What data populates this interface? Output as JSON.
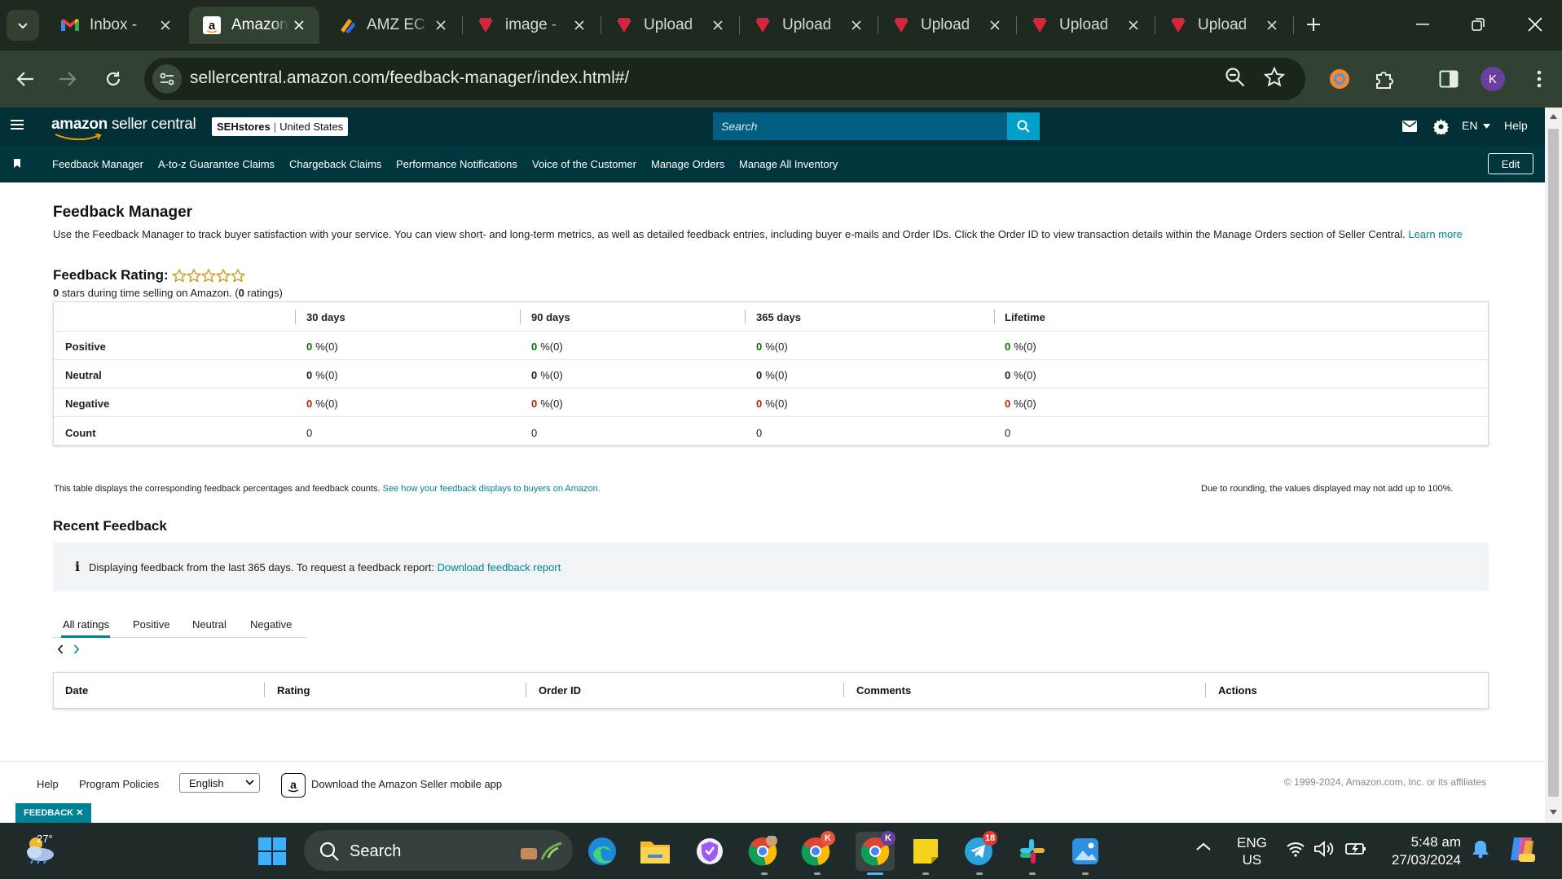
{
  "browser": {
    "tabs": [
      {
        "title": "Inbox -",
        "favicon": "gmail-icon"
      },
      {
        "title": "Amazon",
        "favicon": "amazon-icon",
        "active": true
      },
      {
        "title": "AMZ EC",
        "favicon": "amzec-icon"
      },
      {
        "title": "image -",
        "favicon": "upload-site-icon"
      },
      {
        "title": "Upload",
        "favicon": "upload-site-icon"
      },
      {
        "title": "Upload",
        "favicon": "upload-site-icon"
      },
      {
        "title": "Upload",
        "favicon": "upload-site-icon"
      },
      {
        "title": "Upload",
        "favicon": "upload-site-icon"
      },
      {
        "title": "Upload",
        "favicon": "upload-site-icon"
      }
    ],
    "url": "sellercentral.amazon.com/feedback-manager/index.html#/",
    "profile_initial": "K"
  },
  "amazon_header": {
    "logo_brand": "amazon",
    "logo_product": "seller central",
    "store_name": "SEHstores",
    "store_region": "United States",
    "search_placeholder": "Search",
    "lang": "EN",
    "help": "Help"
  },
  "nav": {
    "items": [
      "Feedback Manager",
      "A-to-z Guarantee Claims",
      "Chargeback Claims",
      "Performance Notifications",
      "Voice of the Customer",
      "Manage Orders",
      "Manage All Inventory"
    ],
    "edit": "Edit"
  },
  "page": {
    "title": "Feedback Manager",
    "description": "Use the Feedback Manager to track buyer satisfaction with your service. You can view short- and long-term metrics, as well as detailed feedback entries, including buyer e-mails and Order IDs. Click the Order ID to view transaction details within the Manage Orders section of Seller Central.",
    "learn_more": "Learn more",
    "rating_label": "Feedback Rating:",
    "rating_stars": 0,
    "stars_value": "0",
    "stars_text": " stars during time selling on Amazon. (",
    "ratings_count": "0",
    "ratings_text": " ratings)"
  },
  "feedback_table": {
    "columns": [
      "30 days",
      "90 days",
      "365 days",
      "Lifetime"
    ],
    "rows": [
      {
        "label": "Positive",
        "values": [
          "0",
          "0",
          "0",
          "0"
        ],
        "counts": [
          "%(0)",
          "%(0)",
          "%(0)",
          "%(0)"
        ],
        "color": "#007600"
      },
      {
        "label": "Neutral",
        "values": [
          "0",
          "0",
          "0",
          "0"
        ],
        "counts": [
          "%(0)",
          "%(0)",
          "%(0)",
          "%(0)"
        ],
        "color": "#222222"
      },
      {
        "label": "Negative",
        "values": [
          "0",
          "0",
          "0",
          "0"
        ],
        "counts": [
          "%(0)",
          "%(0)",
          "%(0)",
          "%(0)"
        ],
        "color": "#b12704"
      },
      {
        "label": "Count",
        "values": [
          "0",
          "0",
          "0",
          "0"
        ]
      }
    ],
    "note_left": "This table displays the corresponding feedback percentages and feedback counts.",
    "note_link": "See how your feedback displays to buyers on Amazon.",
    "note_right": "Due to rounding, the values displayed may not add up to 100%."
  },
  "recent": {
    "title": "Recent Feedback",
    "alert_text": "Displaying feedback from the last 365 days. To request a feedback report:",
    "alert_link": "Download feedback report",
    "tabs": [
      "All ratings",
      "Positive",
      "Neutral",
      "Negative"
    ],
    "columns": [
      "Date",
      "Rating",
      "Order ID",
      "Comments",
      "Actions"
    ]
  },
  "footer": {
    "help": "Help",
    "policies": "Program Policies",
    "language": "English",
    "app_text": "Download the Amazon Seller mobile app",
    "copyright": "© 1999-2024, Amazon.com, Inc. or its affiliates",
    "feedback_tab": "FEEDBACK"
  },
  "taskbar": {
    "temperature": "27°",
    "search": "Search",
    "lang_top": "ENG",
    "lang_bottom": "US",
    "time": "5:48 am",
    "date": "27/03/2024",
    "telegram_badge": "18",
    "chrome_k1": "K",
    "chrome_k2": "K"
  },
  "colors": {
    "amazon_header": "#002f36",
    "accent_link": "#008296",
    "positive": "#007600",
    "negative": "#b12704"
  }
}
